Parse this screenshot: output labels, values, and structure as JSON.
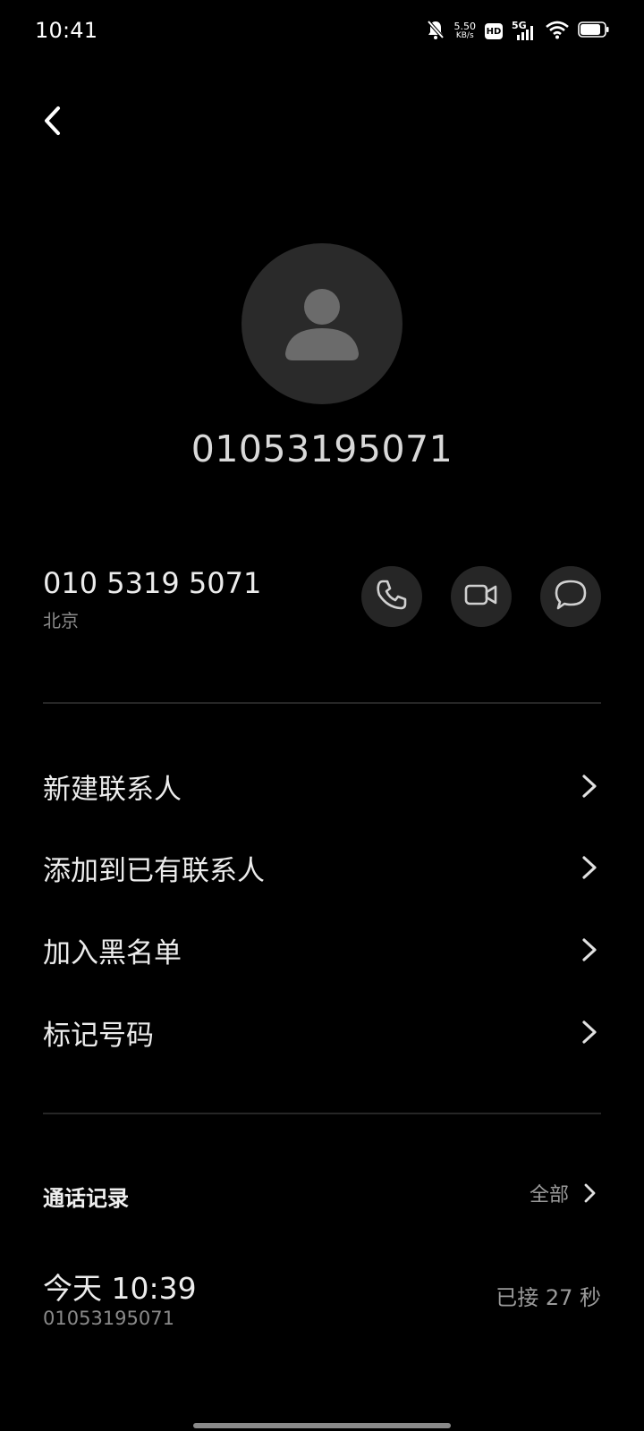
{
  "status_bar": {
    "time": "10:41",
    "net_speed_value": "5.50",
    "net_speed_unit": "KB/s",
    "hd_label": "HD",
    "network_label": "5G",
    "icons": [
      "bell-off-icon",
      "hd-icon",
      "cellular-signal-icon",
      "wifi-icon",
      "battery-icon"
    ]
  },
  "contact": {
    "title_number": "01053195071",
    "phone_formatted": "010 5319 5071",
    "location": "北京",
    "actions": [
      "phone-icon",
      "video-call-icon",
      "message-icon"
    ]
  },
  "menu": {
    "items": [
      {
        "label": "新建联系人"
      },
      {
        "label": "添加到已有联系人"
      },
      {
        "label": "加入黑名单"
      },
      {
        "label": "标记号码"
      }
    ]
  },
  "call_log": {
    "header": "通话记录",
    "all_label": "全部",
    "entries": [
      {
        "time": "今天 10:39",
        "number": "01053195071",
        "status": "已接 27 秒"
      }
    ]
  },
  "colors": {
    "background": "#000000",
    "avatar_bg": "#2a2a2a",
    "button_bg": "#262626",
    "primary_text": "#ececec",
    "secondary_text": "#8a8a8a"
  }
}
